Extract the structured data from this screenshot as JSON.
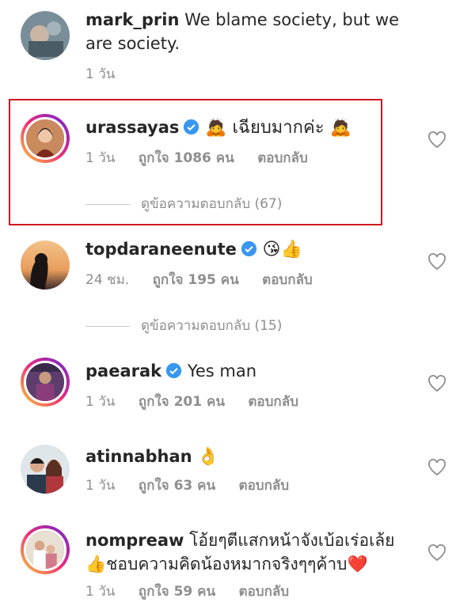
{
  "comments": [
    {
      "username": "mark_prin",
      "verified": false,
      "text": "We blame society, but we are society.",
      "time": "1 วัน",
      "likes": "",
      "reply": ""
    },
    {
      "username": "urassayas",
      "verified": true,
      "text": "🙇 เฉียบมากค่ะ 🙇",
      "time": "1 วัน",
      "likes": "ถูกใจ 1086 คน",
      "reply": "ตอบกลับ",
      "view_replies": "ดูข้อความตอบกลับ (67)"
    },
    {
      "username": "topdaraneenute",
      "verified": true,
      "text": "😘👍",
      "time": "24 ชม.",
      "likes": "ถูกใจ 195 คน",
      "reply": "ตอบกลับ",
      "view_replies": "ดูข้อความตอบกลับ (15)"
    },
    {
      "username": "paearak",
      "verified": true,
      "text": "Yes man",
      "time": "1 วัน",
      "likes": "ถูกใจ 201 คน",
      "reply": "ตอบกลับ"
    },
    {
      "username": "atinnabhan",
      "verified": false,
      "text": "👌",
      "time": "1 วัน",
      "likes": "ถูกใจ 63 คน",
      "reply": "ตอบกลับ"
    },
    {
      "username": "nompreaw",
      "verified": false,
      "text": "โอ้ยๆตีแสกหน้าจังเบ้อเร่อเล้ย 👍ชอบความคิดน้องหมากจริงๆๆค้าบ❤️",
      "time": "1 วัน",
      "likes": "ถูกใจ 59 คน",
      "reply": "ตอบกลับ"
    }
  ],
  "colors": {
    "highlight": "#d0171f",
    "verified": "#3897f0",
    "muted": "#8e8e8e"
  }
}
